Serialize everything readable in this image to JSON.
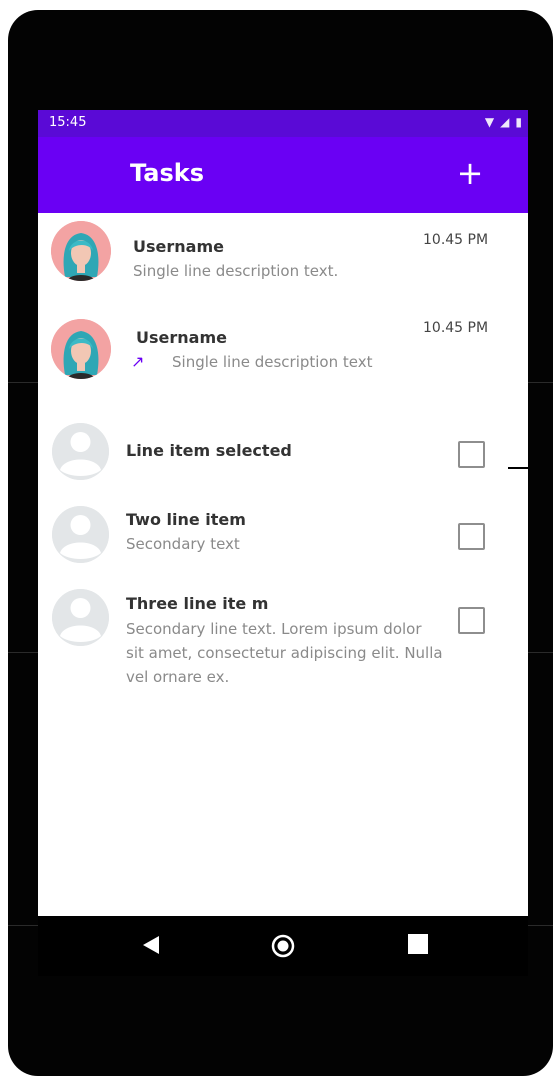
{
  "status_bar": {
    "time": "15:45"
  },
  "app_bar": {
    "title": "Tasks",
    "add_label": "+"
  },
  "messages": [
    {
      "username": "Username",
      "description": "Single line description text.",
      "time": "10.45 PM"
    },
    {
      "username": "Username",
      "description": "Single line description text",
      "time": "10.45 PM",
      "icon": "arrow-up-right-icon"
    }
  ],
  "list_items": [
    {
      "title": "Line item selected",
      "secondary": ""
    },
    {
      "title": "Two line item",
      "secondary": "Secondary text"
    },
    {
      "title": "Three line ite m",
      "secondary": "Secondary line text. Lorem ipsum dolor sit amet, consectetur adipiscing elit. Nulla vel ornare ex."
    }
  ],
  "colors": {
    "accent": "#6a00f4",
    "status_bar": "#5a0ad6",
    "frame": "#030303"
  }
}
